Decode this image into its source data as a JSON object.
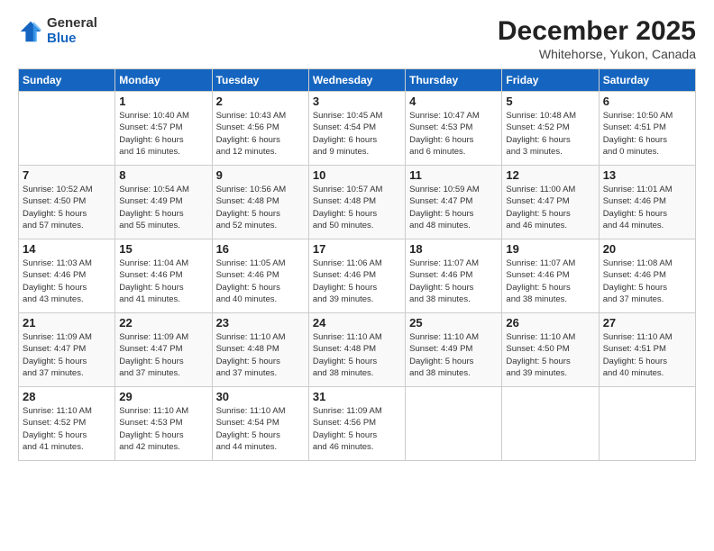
{
  "app": {
    "logo_general": "General",
    "logo_blue": "Blue"
  },
  "header": {
    "month_year": "December 2025",
    "location": "Whitehorse, Yukon, Canada"
  },
  "days_of_week": [
    "Sunday",
    "Monday",
    "Tuesday",
    "Wednesday",
    "Thursday",
    "Friday",
    "Saturday"
  ],
  "weeks": [
    [
      {
        "day": "",
        "info": ""
      },
      {
        "day": "1",
        "info": "Sunrise: 10:40 AM\nSunset: 4:57 PM\nDaylight: 6 hours\nand 16 minutes."
      },
      {
        "day": "2",
        "info": "Sunrise: 10:43 AM\nSunset: 4:56 PM\nDaylight: 6 hours\nand 12 minutes."
      },
      {
        "day": "3",
        "info": "Sunrise: 10:45 AM\nSunset: 4:54 PM\nDaylight: 6 hours\nand 9 minutes."
      },
      {
        "day": "4",
        "info": "Sunrise: 10:47 AM\nSunset: 4:53 PM\nDaylight: 6 hours\nand 6 minutes."
      },
      {
        "day": "5",
        "info": "Sunrise: 10:48 AM\nSunset: 4:52 PM\nDaylight: 6 hours\nand 3 minutes."
      },
      {
        "day": "6",
        "info": "Sunrise: 10:50 AM\nSunset: 4:51 PM\nDaylight: 6 hours\nand 0 minutes."
      }
    ],
    [
      {
        "day": "7",
        "info": "Sunrise: 10:52 AM\nSunset: 4:50 PM\nDaylight: 5 hours\nand 57 minutes."
      },
      {
        "day": "8",
        "info": "Sunrise: 10:54 AM\nSunset: 4:49 PM\nDaylight: 5 hours\nand 55 minutes."
      },
      {
        "day": "9",
        "info": "Sunrise: 10:56 AM\nSunset: 4:48 PM\nDaylight: 5 hours\nand 52 minutes."
      },
      {
        "day": "10",
        "info": "Sunrise: 10:57 AM\nSunset: 4:48 PM\nDaylight: 5 hours\nand 50 minutes."
      },
      {
        "day": "11",
        "info": "Sunrise: 10:59 AM\nSunset: 4:47 PM\nDaylight: 5 hours\nand 48 minutes."
      },
      {
        "day": "12",
        "info": "Sunrise: 11:00 AM\nSunset: 4:47 PM\nDaylight: 5 hours\nand 46 minutes."
      },
      {
        "day": "13",
        "info": "Sunrise: 11:01 AM\nSunset: 4:46 PM\nDaylight: 5 hours\nand 44 minutes."
      }
    ],
    [
      {
        "day": "14",
        "info": "Sunrise: 11:03 AM\nSunset: 4:46 PM\nDaylight: 5 hours\nand 43 minutes."
      },
      {
        "day": "15",
        "info": "Sunrise: 11:04 AM\nSunset: 4:46 PM\nDaylight: 5 hours\nand 41 minutes."
      },
      {
        "day": "16",
        "info": "Sunrise: 11:05 AM\nSunset: 4:46 PM\nDaylight: 5 hours\nand 40 minutes."
      },
      {
        "day": "17",
        "info": "Sunrise: 11:06 AM\nSunset: 4:46 PM\nDaylight: 5 hours\nand 39 minutes."
      },
      {
        "day": "18",
        "info": "Sunrise: 11:07 AM\nSunset: 4:46 PM\nDaylight: 5 hours\nand 38 minutes."
      },
      {
        "day": "19",
        "info": "Sunrise: 11:07 AM\nSunset: 4:46 PM\nDaylight: 5 hours\nand 38 minutes."
      },
      {
        "day": "20",
        "info": "Sunrise: 11:08 AM\nSunset: 4:46 PM\nDaylight: 5 hours\nand 37 minutes."
      }
    ],
    [
      {
        "day": "21",
        "info": "Sunrise: 11:09 AM\nSunset: 4:47 PM\nDaylight: 5 hours\nand 37 minutes."
      },
      {
        "day": "22",
        "info": "Sunrise: 11:09 AM\nSunset: 4:47 PM\nDaylight: 5 hours\nand 37 minutes."
      },
      {
        "day": "23",
        "info": "Sunrise: 11:10 AM\nSunset: 4:48 PM\nDaylight: 5 hours\nand 37 minutes."
      },
      {
        "day": "24",
        "info": "Sunrise: 11:10 AM\nSunset: 4:48 PM\nDaylight: 5 hours\nand 38 minutes."
      },
      {
        "day": "25",
        "info": "Sunrise: 11:10 AM\nSunset: 4:49 PM\nDaylight: 5 hours\nand 38 minutes."
      },
      {
        "day": "26",
        "info": "Sunrise: 11:10 AM\nSunset: 4:50 PM\nDaylight: 5 hours\nand 39 minutes."
      },
      {
        "day": "27",
        "info": "Sunrise: 11:10 AM\nSunset: 4:51 PM\nDaylight: 5 hours\nand 40 minutes."
      }
    ],
    [
      {
        "day": "28",
        "info": "Sunrise: 11:10 AM\nSunset: 4:52 PM\nDaylight: 5 hours\nand 41 minutes."
      },
      {
        "day": "29",
        "info": "Sunrise: 11:10 AM\nSunset: 4:53 PM\nDaylight: 5 hours\nand 42 minutes."
      },
      {
        "day": "30",
        "info": "Sunrise: 11:10 AM\nSunset: 4:54 PM\nDaylight: 5 hours\nand 44 minutes."
      },
      {
        "day": "31",
        "info": "Sunrise: 11:09 AM\nSunset: 4:56 PM\nDaylight: 5 hours\nand 46 minutes."
      },
      {
        "day": "",
        "info": ""
      },
      {
        "day": "",
        "info": ""
      },
      {
        "day": "",
        "info": ""
      }
    ]
  ]
}
